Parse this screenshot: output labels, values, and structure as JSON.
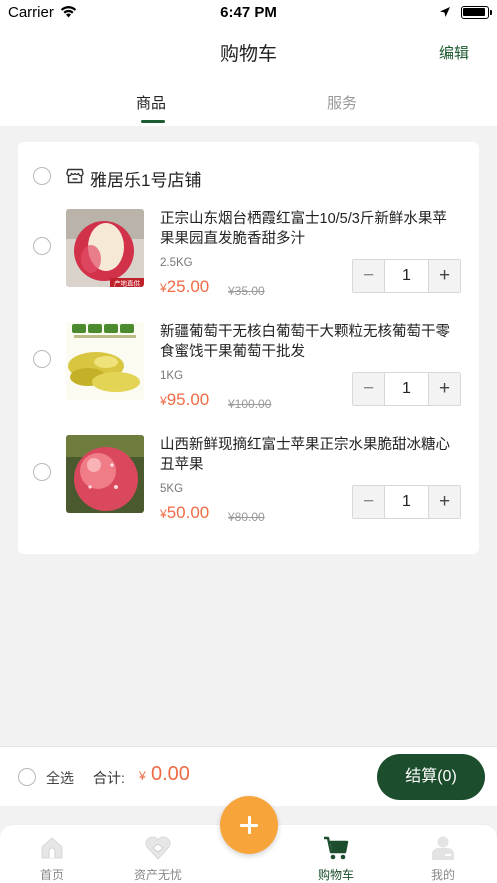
{
  "status_bar": {
    "carrier": "Carrier",
    "time": "6:47 PM"
  },
  "nav": {
    "title": "购物车",
    "edit_label": "编辑"
  },
  "tabs": [
    {
      "label": "商品",
      "active": true
    },
    {
      "label": "服务",
      "active": false
    }
  ],
  "shop": {
    "name": "雅居乐1号店铺"
  },
  "currency_symbol": "¥",
  "items": [
    {
      "name": "正宗山东烟台栖霞红富士10/5/3斤新鲜水果苹果果园直发脆香甜多汁",
      "spec": "2.5KG",
      "price": "25.00",
      "original_price": "¥35.00",
      "quantity": "1",
      "image_badge": "产地直供"
    },
    {
      "name": "新疆葡萄干无核白葡萄干大颗粒无核葡萄干零食蜜饯干果葡萄干批发",
      "spec": "1KG",
      "price": "95.00",
      "original_price": "¥100.00",
      "quantity": "1"
    },
    {
      "name": "山西新鲜现摘红富士苹果正宗水果脆甜冰糖心丑苹果",
      "spec": "5KG",
      "price": "50.00",
      "original_price": "¥80.00",
      "quantity": "1"
    }
  ],
  "footer": {
    "select_all_label": "全选",
    "total_label": "合计:",
    "total_value": "0.00",
    "checkout_label": "结算(0)"
  },
  "tabbar": [
    {
      "label": "首页",
      "icon": "home-icon",
      "active": false
    },
    {
      "label": "资产无忧",
      "icon": "asset-icon",
      "active": false
    },
    {
      "label": "购物车",
      "icon": "cart-icon",
      "active": true
    },
    {
      "label": "我的",
      "icon": "profile-icon",
      "active": false
    }
  ],
  "colors": {
    "brand_green": "#1c4d2c",
    "price_orange": "#ee6b45",
    "fab_orange": "#f7a53b"
  }
}
